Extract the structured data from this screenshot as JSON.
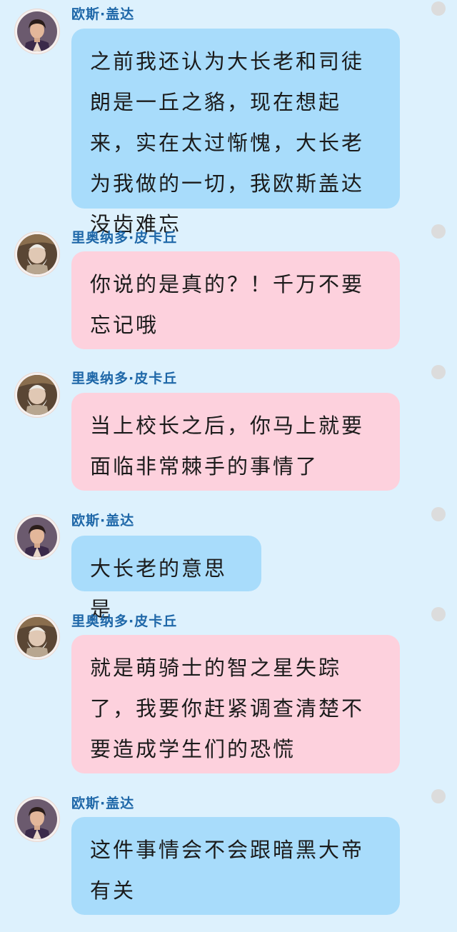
{
  "messages": [
    {
      "sender": "欧斯·盖达",
      "text": "之前我还认为大长老和司徒朗是一丘之貉，现在想起来，实在太过惭愧，大长老为我做的一切，我欧斯盖达没齿难忘"
    },
    {
      "sender": "里奥纳多·皮卡丘",
      "text": "你说的是真的？！千万不要忘记哦"
    },
    {
      "sender": "里奥纳多·皮卡丘",
      "text": "当上校长之后，你马上就要面临非常棘手的事情了"
    },
    {
      "sender": "欧斯·盖达",
      "text": "大长老的意思是"
    },
    {
      "sender": "里奥纳多·皮卡丘",
      "text": "就是萌骑士的智之星失踪了，我要你赶紧调查清楚不要造成学生们的恐慌"
    },
    {
      "sender": "欧斯·盖达",
      "text": "这件事情会不会跟暗黑大帝有关"
    }
  ],
  "colors": {
    "background": "#ddf1fd",
    "bubble_blue": "#a8dcfb",
    "bubble_pink": "#fdd1dd",
    "sender_name": "#1e67a8"
  }
}
